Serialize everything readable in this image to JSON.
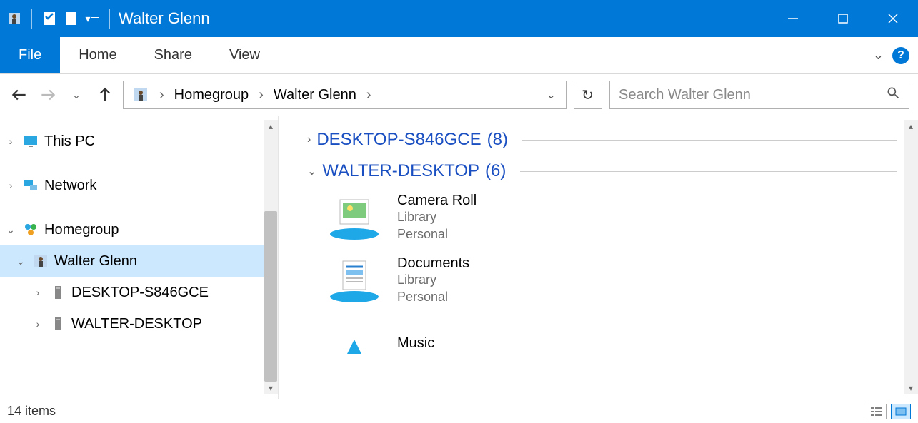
{
  "window": {
    "title": "Walter Glenn"
  },
  "ribbon": {
    "file": "File",
    "tabs": [
      "Home",
      "Share",
      "View"
    ]
  },
  "nav": {
    "breadcrumb": [
      "Homegroup",
      "Walter Glenn"
    ],
    "search_placeholder": "Search Walter Glenn"
  },
  "tree": {
    "this_pc": "This PC",
    "network": "Network",
    "homegroup": "Homegroup",
    "walter": "Walter Glenn",
    "desktop1": "DESKTOP-S846GCE",
    "desktop2": "WALTER-DESKTOP"
  },
  "groups": [
    {
      "name": "DESKTOP-S846GCE",
      "count": "(8)",
      "expanded": false
    },
    {
      "name": "WALTER-DESKTOP",
      "count": "(6)",
      "expanded": true
    }
  ],
  "items": [
    {
      "title": "Camera Roll",
      "line1": "Library",
      "line2": "Personal"
    },
    {
      "title": "Documents",
      "line1": "Library",
      "line2": "Personal"
    },
    {
      "title": "Music",
      "line1": "",
      "line2": ""
    }
  ],
  "status": {
    "count": "14 items"
  }
}
